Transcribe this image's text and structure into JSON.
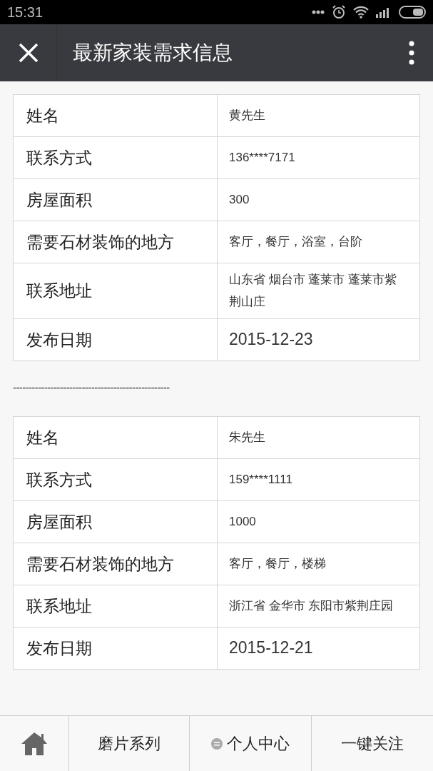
{
  "status_bar": {
    "time": "15:31"
  },
  "header": {
    "title": "最新家装需求信息"
  },
  "records": [
    {
      "rows": [
        {
          "label": "姓名",
          "value": "黄先生",
          "kind": "text"
        },
        {
          "label": "联系方式",
          "value": "136****7171",
          "kind": "text"
        },
        {
          "label": "房屋面积",
          "value": "300",
          "kind": "text"
        },
        {
          "label": "需要石材装饰的地方",
          "value": "客厅，餐厅，浴室，台阶",
          "kind": "text"
        },
        {
          "label": "联系地址",
          "value": "山东省 烟台市 蓬莱市 蓬莱市紫荆山庄",
          "kind": "text"
        },
        {
          "label": "发布日期",
          "value": "2015-12-23",
          "kind": "date"
        }
      ],
      "separator": "--------------------------------------------------"
    },
    {
      "rows": [
        {
          "label": "姓名",
          "value": "朱先生",
          "kind": "text"
        },
        {
          "label": "联系方式",
          "value": "159****1111",
          "kind": "text"
        },
        {
          "label": "房屋面积",
          "value": "1000",
          "kind": "text"
        },
        {
          "label": "需要石材装饰的地方",
          "value": "客厅，餐厅，楼梯",
          "kind": "text"
        },
        {
          "label": "联系地址",
          "value": "浙江省 金华市 东阳市紫荆庄园",
          "kind": "text"
        },
        {
          "label": "发布日期",
          "value": "2015-12-21",
          "kind": "date"
        }
      ]
    }
  ],
  "bottom_nav": [
    {
      "kind": "home"
    },
    {
      "kind": "text",
      "label": "磨片系列"
    },
    {
      "kind": "menu",
      "label": "个人中心"
    },
    {
      "kind": "text",
      "label": "一键关注"
    }
  ]
}
